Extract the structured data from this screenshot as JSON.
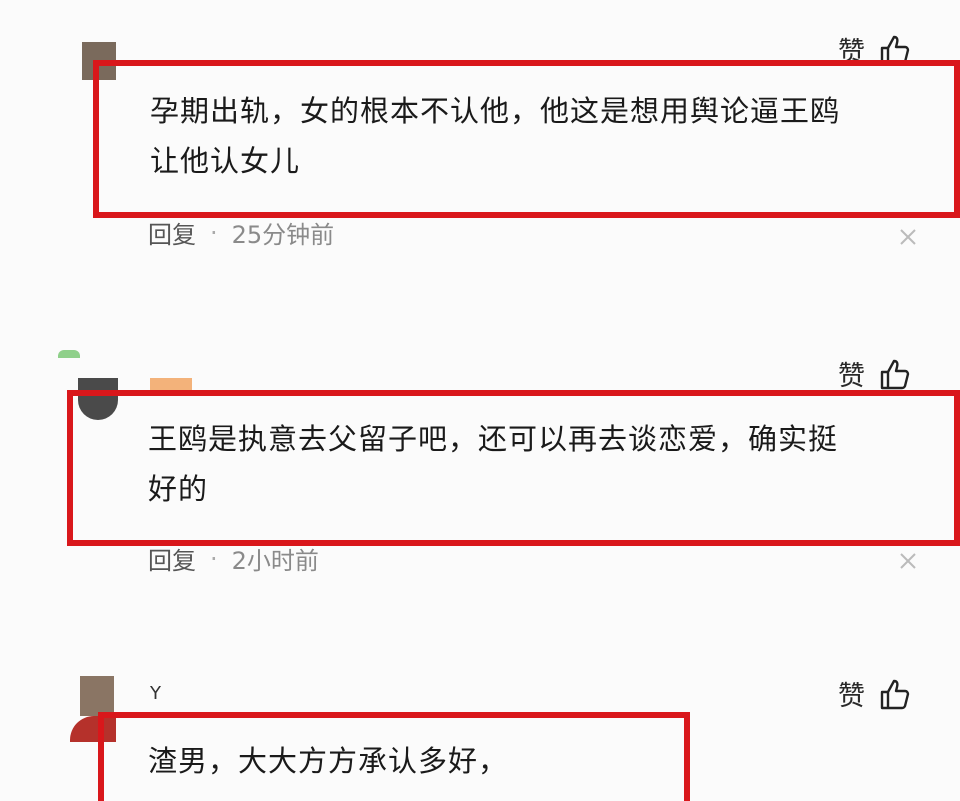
{
  "comments": [
    {
      "like_label": "赞",
      "nickname": "",
      "content_line1": "孕期出轨，女的根本不认他，他这是想用舆论逼王鸥",
      "content_line2": "让他认女儿",
      "reply_label": "回复",
      "separator": "·",
      "time": "25分钟前"
    },
    {
      "like_label": "赞",
      "nickname": "",
      "content_line1": "王鸥是执意去父留子吧，还可以再去谈恋爱，确实挺",
      "content_line2": "好的",
      "reply_label": "回复",
      "separator": "·",
      "time": "2小时前"
    },
    {
      "like_label": "赞",
      "nickname": "Y",
      "content_line1": "渣男，大大方方承认多好，",
      "content_line2": "",
      "reply_label": "",
      "separator": "",
      "time": ""
    }
  ],
  "colors": {
    "highlight_border": "#d9171b",
    "text": "#1a1a1a",
    "meta_text": "#8a8a8a",
    "background": "#fbfbfb"
  },
  "icons": {
    "like": "thumbs-up-icon",
    "close": "close-icon"
  }
}
